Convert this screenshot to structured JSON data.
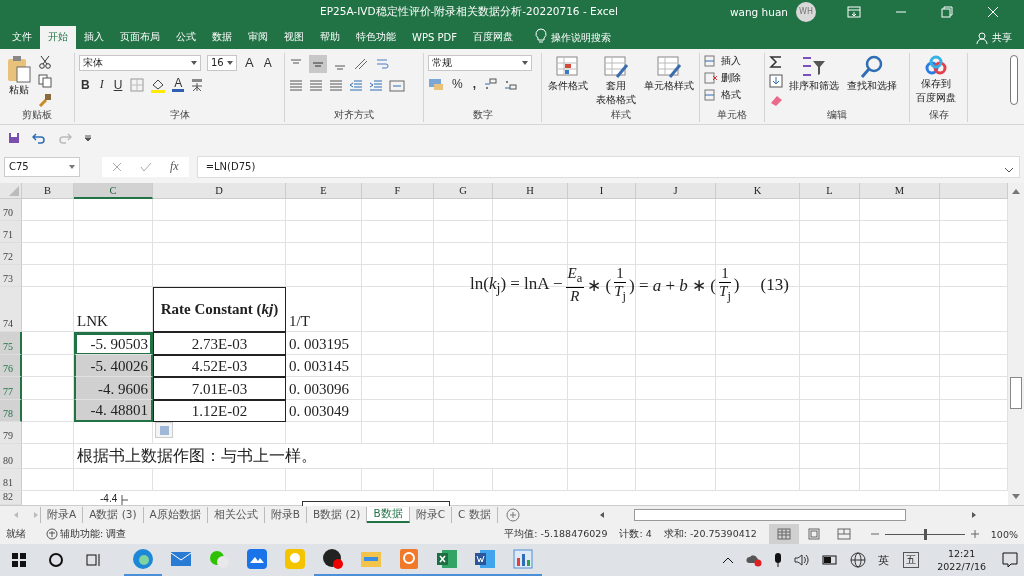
{
  "window": {
    "title": "EP25A-IVD稳定性评价-附录相关数据分析-20220716  -  Excel",
    "user": "wang huan",
    "avatar": "WH"
  },
  "ribbon_tabs": [
    {
      "label": "文件",
      "selected": false
    },
    {
      "label": "开始",
      "selected": true
    },
    {
      "label": "插入",
      "selected": false
    },
    {
      "label": "页面布局",
      "selected": false
    },
    {
      "label": "公式",
      "selected": false
    },
    {
      "label": "数据",
      "selected": false
    },
    {
      "label": "审阅",
      "selected": false
    },
    {
      "label": "视图",
      "selected": false
    },
    {
      "label": "帮助",
      "selected": false
    },
    {
      "label": "特色功能",
      "selected": false
    },
    {
      "label": "WPS PDF",
      "selected": false
    },
    {
      "label": "百度网盘",
      "selected": false
    }
  ],
  "tell_me": {
    "placeholder": "操作说明搜索"
  },
  "share": "共享",
  "clipboard": {
    "paste": "粘贴",
    "title": "剪贴板"
  },
  "font": {
    "name": "宋体",
    "size": "16",
    "grow": "A",
    "shrink": "A",
    "bold": "B",
    "italic": "I",
    "underline": "U",
    "color_letter": "A",
    "title": "字体"
  },
  "alignment": {
    "title": "对齐方式"
  },
  "number": {
    "format": "常规",
    "percent": "%",
    "comma": ",",
    "title": "数字"
  },
  "styles": {
    "items": [
      {
        "lines": [
          "条件格式"
        ]
      },
      {
        "lines": [
          "套用",
          "表格格式"
        ]
      },
      {
        "lines": [
          "单元格样式"
        ]
      }
    ],
    "title": "样式"
  },
  "cells_group": {
    "items": [
      "插入",
      "删除",
      "格式"
    ],
    "title": "单元格"
  },
  "editing": {
    "sort": "排序和筛选",
    "find": "查找和选择",
    "title": "编辑"
  },
  "save": {
    "lines": [
      "保存到",
      "百度网盘"
    ],
    "title": "保存"
  },
  "formula_bar": {
    "name_box": "C75",
    "fx": "fx",
    "formula": "=LN(D75)"
  },
  "columns": [
    {
      "label": "B",
      "selected": false
    },
    {
      "label": "C",
      "selected": true
    },
    {
      "label": "D",
      "selected": false
    },
    {
      "label": "E",
      "selected": false
    },
    {
      "label": "F",
      "selected": false
    },
    {
      "label": "G",
      "selected": false
    },
    {
      "label": "H",
      "selected": false
    },
    {
      "label": "I",
      "selected": false
    },
    {
      "label": "J",
      "selected": false
    },
    {
      "label": "K",
      "selected": false
    },
    {
      "label": "L",
      "selected": false
    },
    {
      "label": "M",
      "selected": false
    }
  ],
  "rows": [
    {
      "number": "70",
      "selected": false
    },
    {
      "number": "71",
      "selected": false
    },
    {
      "number": "72",
      "selected": false
    },
    {
      "number": "73",
      "selected": false
    },
    {
      "number": "74",
      "selected": false,
      "cells": [
        {
          "kind": "label",
          "text": "LNK",
          "selected": false,
          "active": false,
          "bordered": false
        },
        {
          "kind": "heading",
          "text": "Rate Constant (*kj*)",
          "selected": false,
          "active": false,
          "bordered": true
        },
        {
          "kind": "label",
          "text": "1/T",
          "selected": false,
          "active": false,
          "bordered": false
        }
      ]
    },
    {
      "number": "75",
      "selected": true,
      "cells": [
        {
          "kind": "number",
          "text": "-5. 90503",
          "selected": true,
          "active": true,
          "bordered": false
        },
        {
          "kind": "centered",
          "text": "2.73E-03",
          "selected": false,
          "active": false,
          "bordered": true
        },
        {
          "kind": "value",
          "text": "0. 003195",
          "selected": false,
          "active": false,
          "bordered": false
        }
      ]
    },
    {
      "number": "76",
      "selected": true,
      "cells": [
        {
          "kind": "number",
          "text": "-5. 40026",
          "selected": true,
          "active": false,
          "bordered": false
        },
        {
          "kind": "centered",
          "text": "4.52E-03",
          "selected": false,
          "active": false,
          "bordered": true
        },
        {
          "kind": "value",
          "text": "0. 003145",
          "selected": false,
          "active": false,
          "bordered": false
        }
      ]
    },
    {
      "number": "77",
      "selected": true,
      "cells": [
        {
          "kind": "number",
          "text": "-4. 9606",
          "selected": true,
          "active": false,
          "bordered": false
        },
        {
          "kind": "centered",
          "text": "7.01E-03",
          "selected": false,
          "active": false,
          "bordered": true
        },
        {
          "kind": "value",
          "text": "0. 003096",
          "selected": false,
          "active": false,
          "bordered": false
        }
      ]
    },
    {
      "number": "78",
      "selected": true,
      "cells": [
        {
          "kind": "number",
          "text": "-4. 48801",
          "selected": true,
          "active": false,
          "bordered": false
        },
        {
          "kind": "centered",
          "text": "1.12E-02",
          "selected": false,
          "active": false,
          "bordered": true
        },
        {
          "kind": "value",
          "text": "0. 003049",
          "selected": false,
          "active": false,
          "bordered": false
        }
      ]
    },
    {
      "number": "79",
      "selected": false
    },
    {
      "number": "80",
      "selected": false,
      "cells": [
        {
          "kind": "note",
          "text": "根据书上数据作图：与书上一样。",
          "selected": false,
          "active": false,
          "bordered": false
        }
      ]
    },
    {
      "number": "81",
      "selected": false
    },
    {
      "number": "82",
      "selected": false
    }
  ],
  "equation": {
    "parts": [
      {
        "kind": "text",
        "text": "ln(*k*$_{j}$) = lnA −"
      },
      {
        "kind": "frac",
        "num": "*E*$_{a}$",
        "den": "*R*"
      },
      {
        "kind": "text",
        "text": "∗ ("
      },
      {
        "kind": "frac",
        "num": "1",
        "den": "*T*$_{j}$"
      },
      {
        "kind": "text",
        "text": ") = *a* + *b* ∗ ("
      },
      {
        "kind": "frac",
        "num": "1",
        "den": "*T*$_{j}$"
      },
      {
        "kind": "text",
        "text": ")"
      },
      {
        "kind": "tag",
        "text": "(13)"
      }
    ]
  },
  "chart_fragment": {
    "tick": "-4.4"
  },
  "sheet_tabs": [
    {
      "label": "附录A",
      "selected": false
    },
    {
      "label": "A数据 (3)",
      "selected": false
    },
    {
      "label": "A原始数据",
      "selected": false
    },
    {
      "label": "相关公式",
      "selected": false
    },
    {
      "label": "附录B",
      "selected": false
    },
    {
      "label": "B数据 (2)",
      "selected": false
    },
    {
      "label": "B数据",
      "selected": true
    },
    {
      "label": "附录C",
      "selected": false
    },
    {
      "label": "C 数据",
      "selected": false
    }
  ],
  "status_bar": {
    "ready": "就绪",
    "accessibility": "辅助功能: 调查",
    "average": "平均值: -5.188476029",
    "count": "计数: 4",
    "sum": "求和: -20.75390412",
    "views": [
      {
        "kind": "normal",
        "selected": true
      },
      {
        "kind": "page_layout",
        "selected": false
      },
      {
        "kind": "page_break",
        "selected": false
      }
    ],
    "zoom": {
      "level": 0.5,
      "reading": "100%"
    }
  },
  "taskbar": {
    "apps": [
      {
        "kind": "browser",
        "running": true
      },
      {
        "kind": "mail",
        "running": false
      },
      {
        "kind": "chat",
        "running": false
      },
      {
        "kind": "cloud",
        "running": false
      },
      {
        "kind": "player",
        "running": false
      },
      {
        "kind": "media",
        "running": true
      },
      {
        "kind": "folder",
        "running": true
      },
      {
        "kind": "pdf",
        "running": true
      },
      {
        "kind": "spreadsheet",
        "running": true
      },
      {
        "kind": "document",
        "running": true
      },
      {
        "kind": "chart",
        "running": true
      }
    ],
    "ime_lang": "英",
    "ime_mode": "五",
    "time": "12:21",
    "date": "2022/7/16"
  }
}
